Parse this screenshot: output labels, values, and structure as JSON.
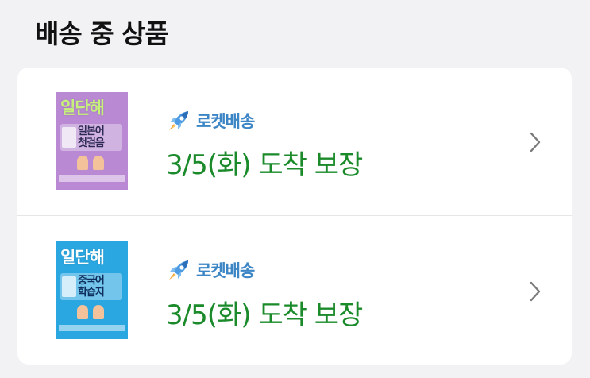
{
  "section": {
    "title": "배송 중 상품"
  },
  "items": [
    {
      "cover_brand": "일단해",
      "cover_subtitle_1": "일본어",
      "cover_subtitle_2": "첫걸음",
      "delivery_type": "로켓배송",
      "arrival_text": "3/5(화) 도착 보장",
      "cover_color": "#b98ad3",
      "icon": "rocket-icon"
    },
    {
      "cover_brand": "일단해",
      "cover_subtitle_1": "중국어",
      "cover_subtitle_2": "학습지",
      "delivery_type": "로켓배송",
      "arrival_text": "3/5(화) 도착 보장",
      "cover_color": "#2aa7e1",
      "icon": "rocket-icon"
    }
  ],
  "colors": {
    "arrival": "#1a8a2a",
    "rocket_label": "#3d86c6",
    "background": "#f2f2f4"
  }
}
